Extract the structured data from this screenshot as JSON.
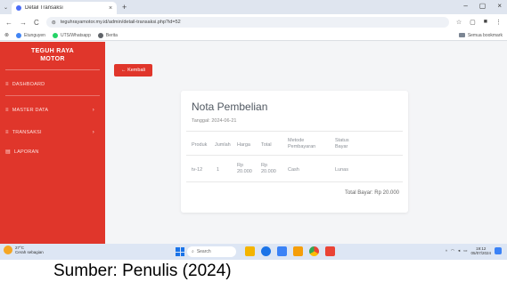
{
  "browser": {
    "tab_title": "Detail Transaksi",
    "tab_close": "×",
    "tab_dropdown": "⌄",
    "new_tab": "+",
    "window_controls": [
      "–",
      "▢",
      "×"
    ],
    "url": "teguhrayamotor.my.id/admin/detail-transaksi.php?id=52",
    "nav": {
      "back": "←",
      "forward": "→",
      "reload": "C"
    },
    "bookmarks": [
      {
        "label": "Etunguyen",
        "color": "#4285f4"
      },
      {
        "label": "UTS/Whatsapp",
        "color": "#25d366"
      },
      {
        "label": "Berita",
        "color": "#5f6368"
      }
    ],
    "bookmarks_right": "Semua bookmark"
  },
  "sidebar": {
    "brand_line1": "TEGUH RAYA",
    "brand_line2": "MOTOR",
    "items": [
      {
        "label": "DASHBOARD",
        "icon": "≡",
        "chevron": ""
      },
      {
        "label": "MASTER DATA",
        "icon": "≡",
        "chevron": "›"
      },
      {
        "label": "TRANSAKSI",
        "icon": "≡",
        "chevron": "›"
      },
      {
        "label": "LAPORAN",
        "icon": "▤",
        "chevron": ""
      }
    ]
  },
  "main": {
    "back_label": "← Kembali",
    "title": "Nota Pembelian",
    "date": "Tanggal: 2024-06-21",
    "columns": [
      "Produk",
      "Jumlah",
      "Harga",
      "Total",
      "Metode Pembayaran",
      "Status Bayar"
    ],
    "rows": [
      {
        "produk": "tv-12",
        "jumlah": "1",
        "harga": "Rp 20.000",
        "total": "Rp 20.000",
        "metode": "Cash",
        "status": "Lunas"
      }
    ],
    "total_label": "Total Bayar: Rp 20.000"
  },
  "taskbar": {
    "weather_temp": "27°C",
    "weather_desc": "Cerah sebagian",
    "search_placeholder": "Search",
    "time": "19:12",
    "date": "05/07/2024",
    "apps": [
      {
        "name": "explorer",
        "color": "#f4b400"
      },
      {
        "name": "browser",
        "color": "#1a73e8"
      },
      {
        "name": "store",
        "color": "#3b82f6"
      },
      {
        "name": "files",
        "color": "#f59e0b"
      },
      {
        "name": "chrome",
        "color": "#34a853"
      },
      {
        "name": "app",
        "color": "#ea4335"
      }
    ]
  },
  "caption": "Sumber: Penulis (2024)",
  "colors": {
    "accent": "#e0362b",
    "background": "#f4f5f7",
    "card": "#ffffff"
  }
}
